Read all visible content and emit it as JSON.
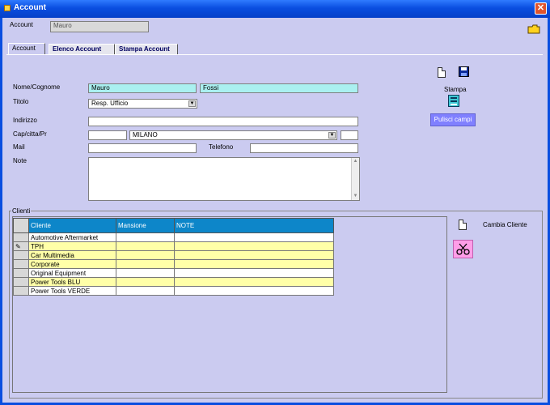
{
  "window": {
    "title": "Account",
    "close_glyph": "✕"
  },
  "header": {
    "account_label": "Account",
    "account_value": "Mauro"
  },
  "tabs": [
    {
      "label": "Account"
    },
    {
      "label": "Elenco Account"
    },
    {
      "label": "Stampa Account"
    }
  ],
  "form": {
    "nome_label": "Nome/Cognome",
    "nome": "Mauro",
    "cognome": "Fossi",
    "titolo_label": "Titolo",
    "titolo": "Resp. Ufficio",
    "indirizzo_label": "Indirizzo",
    "indirizzo": "",
    "cap_label": "Cap/citta/Pr",
    "cap": "",
    "citta": "MILANO",
    "prov": "",
    "mail_label": "Mail",
    "mail": "",
    "telefono_label": "Telefono",
    "telefono": "",
    "note_label": "Note",
    "note": ""
  },
  "actions": {
    "stampa_label": "Stampa",
    "pulisci_label": "Pulisci campi"
  },
  "clienti": {
    "group_label": "Clienti",
    "columns": [
      "Cliente",
      "Mansione",
      "NOTE"
    ],
    "rows": [
      {
        "cliente": "Automotive Aftermarket",
        "mansione": "",
        "note": "",
        "marker": "",
        "style": "white"
      },
      {
        "cliente": "TPH",
        "mansione": "",
        "note": "",
        "marker": "✎",
        "style": "yellow"
      },
      {
        "cliente": "Car Multimedia",
        "mansione": "",
        "note": "",
        "marker": "",
        "style": "yellow"
      },
      {
        "cliente": "Corporate",
        "mansione": "",
        "note": "",
        "marker": "",
        "style": "yellow"
      },
      {
        "cliente": "Original Equipment",
        "mansione": "",
        "note": "",
        "marker": "",
        "style": "white"
      },
      {
        "cliente": "Power Tools BLU",
        "mansione": "",
        "note": "",
        "marker": "",
        "style": "yellow"
      },
      {
        "cliente": "Power Tools VERDE",
        "mansione": "",
        "note": "",
        "marker": "",
        "style": "white"
      }
    ],
    "cambia_label": "Cambia Cliente"
  },
  "icons": [
    "folder-icon",
    "new-document-icon",
    "save-disk-icon",
    "print-icon",
    "cut-icon"
  ]
}
